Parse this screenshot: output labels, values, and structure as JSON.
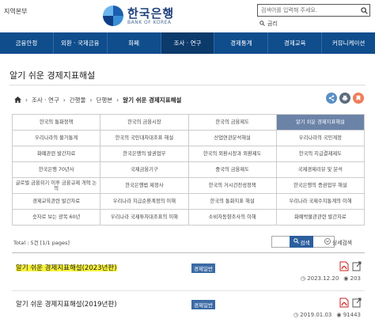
{
  "header": {
    "region": "지역본부",
    "logo_ko": "한국은행",
    "logo_en": "BANK OF KOREA",
    "search_placeholder": "검색어를 입력해 주세요.",
    "glossary": "금리"
  },
  "nav": [
    {
      "label": "금융안정"
    },
    {
      "label": "외환 · 국제금융"
    },
    {
      "label": "화폐"
    },
    {
      "label": "조사 · 연구"
    },
    {
      "label": "경제통계"
    },
    {
      "label": "경제교육"
    },
    {
      "label": "커뮤니케이션"
    }
  ],
  "page_title": "알기 쉬운 경제지표해설",
  "breadcrumb": [
    "조사 · 연구",
    "간행물",
    "단행본",
    "알기 쉬운 경제지표해설"
  ],
  "categories": [
    "한국의 통화정책",
    "한국의 금융시장",
    "한국의 금융제도",
    "알기 쉬운 경제지표해설",
    "우리나라의 물가통계",
    "한국의 국민대차대조표 해설",
    "산업연관분석해설",
    "우리나라의 국민계정",
    "화폐관련 발간자료",
    "한국은행의 발권업무",
    "한국의 외환시장과 외환제도",
    "한국의 지급결제제도",
    "한국은행 70년사",
    "국제금융기구",
    "중국의 금융제도",
    "국제경제리뷰 및 분석",
    "글로벌 금융위기 이후 금융규제 개혁 논의",
    "한국은행법 제정사",
    "한국의 거시건전성정책",
    "한국은행의 증권업무 해설",
    "경제교육관련 발간자료",
    "우리나라 지급순환계정의 이해",
    "한국의 통화지표 해설",
    "우리나라 국제수지통계의 이해",
    "숫자로 보는 광복 60년",
    "우리나라 국제투자대조표의 이해",
    "소비자동향조사의 이해",
    "화폐박물관관련 발간자료"
  ],
  "total": "Total : 5건 [1/1 pages]",
  "list_search_label": "검색",
  "detail_search_label": "상세검색",
  "results": [
    {
      "title": "알기 쉬운 경제지표해설(2023년판)",
      "tag": "경제일반",
      "date": "2023.12.20",
      "views": "203"
    },
    {
      "title": "알기 쉬운 경제지표해설(2019년판)",
      "tag": "경제일반",
      "date": "2019.01.03",
      "views": "91443"
    }
  ],
  "colors": {
    "nav": "#0f4d8c",
    "nav_active": "#0b3a6b",
    "grid_active": "#6c83a8",
    "tag": "#3b6aa5",
    "highlight": "#f7f23b"
  }
}
